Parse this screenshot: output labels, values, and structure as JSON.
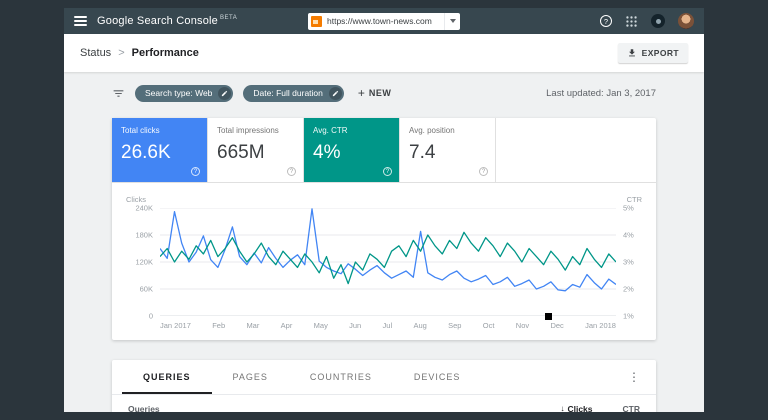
{
  "topbar": {
    "app_title": "Google Search Console",
    "beta_tag": "BETA",
    "property_url": "https://www.town-news.com"
  },
  "breadcrumb": {
    "section": "Status",
    "separator": ">",
    "page": "Performance"
  },
  "export_button": "EXPORT",
  "filters": {
    "search_type_chip": "Search type: Web",
    "date_chip": "Date: Full duration",
    "new_plus": "+",
    "new_button": "NEW",
    "last_updated": "Last updated: Jan 3, 2017"
  },
  "metrics": [
    {
      "label": "Total clicks",
      "value": "26.6K",
      "selected": true,
      "accent": "#4285F4"
    },
    {
      "label": "Total impressions",
      "value": "665M",
      "selected": false,
      "accent": "#FFFFFF"
    },
    {
      "label": "Avg. CTR",
      "value": "4%",
      "selected": true,
      "accent": "#009688"
    },
    {
      "label": "Avg. position",
      "value": "7.4",
      "selected": false,
      "accent": "#FFFFFF"
    }
  ],
  "chart_data": {
    "type": "line",
    "title": "Clicks and CTR over time",
    "grid": true,
    "legend_position": "none",
    "x_axis_labels": [
      "Jan 2017",
      "Feb",
      "Mar",
      "Apr",
      "May",
      "Jun",
      "Jul",
      "Aug",
      "Sep",
      "Oct",
      "Nov",
      "Dec",
      "Jan 2018"
    ],
    "left_axis": {
      "label": "Clicks",
      "ticks": [
        "240K",
        "180K",
        "120K",
        "60K",
        "0"
      ],
      "min": 0,
      "max": 240000
    },
    "right_axis": {
      "label": "CTR",
      "ticks": [
        "5%",
        "4%",
        "3%",
        "2%",
        "1%"
      ],
      "min_pct": 1,
      "max_pct": 5
    },
    "series": [
      {
        "name": "Clicks",
        "axis": "left",
        "color": "#4285F4",
        "unit": "thousands of clicks",
        "values": [
          150,
          128,
          232,
          162,
          120,
          142,
          178,
          125,
          108,
          148,
          198,
          132,
          114,
          140,
          118,
          152,
          128,
          108,
          124,
          136,
          114,
          238,
          122,
          108,
          100,
          94,
          116,
          104,
          90,
          102,
          112,
          96,
          84,
          92,
          100,
          86,
          188,
          96,
          86,
          80,
          92,
          100,
          84,
          76,
          82,
          90,
          70,
          76,
          86,
          66,
          72,
          80,
          60,
          66,
          76,
          58,
          56,
          70,
          64,
          92,
          74,
          60,
          82,
          70
        ]
      },
      {
        "name": "CTR",
        "axis": "right",
        "color": "#009688",
        "unit": "percent",
        "values": [
          3.2,
          3.5,
          3.0,
          3.4,
          3.1,
          3.6,
          3.3,
          3.8,
          3.2,
          3.5,
          3.9,
          3.4,
          3.0,
          3.3,
          3.7,
          3.2,
          2.9,
          3.4,
          3.1,
          2.8,
          3.3,
          3.0,
          2.6,
          3.2,
          2.4,
          2.9,
          2.2,
          3.0,
          2.7,
          3.3,
          3.1,
          2.8,
          3.4,
          3.6,
          3.2,
          3.8,
          3.4,
          4.0,
          3.6,
          3.3,
          3.8,
          3.5,
          4.1,
          3.7,
          3.4,
          3.9,
          3.6,
          3.2,
          3.7,
          3.4,
          3.0,
          3.5,
          3.2,
          2.9,
          3.4,
          3.1,
          2.7,
          3.2,
          2.9,
          3.5,
          3.1,
          2.8,
          3.3,
          3.0
        ]
      }
    ]
  },
  "tabs": [
    {
      "label": "QUERIES",
      "active": true
    },
    {
      "label": "PAGES",
      "active": false
    },
    {
      "label": "COUNTRIES",
      "active": false
    },
    {
      "label": "DEVICES",
      "active": false
    }
  ],
  "table": {
    "row_header": "Queries",
    "sort_arrow": "↓",
    "sort_column": "Clicks",
    "second_column": "CTR"
  },
  "help_glyph": "?",
  "dots_glyph": "⋮"
}
